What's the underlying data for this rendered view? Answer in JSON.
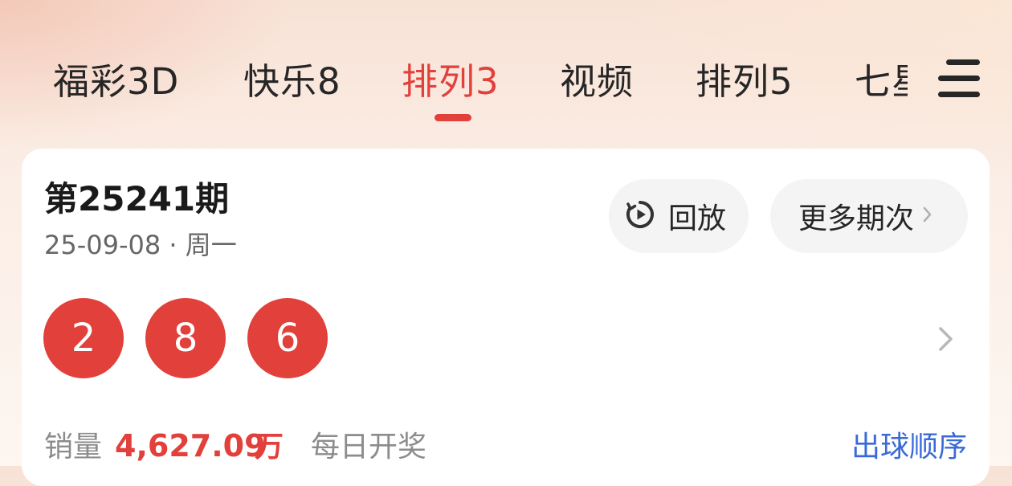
{
  "tabs": [
    {
      "label": "福彩3D",
      "active": false
    },
    {
      "label": "快乐8",
      "active": false
    },
    {
      "label": "排列3",
      "active": true
    },
    {
      "label": "视频",
      "active": false
    },
    {
      "label": "排列5",
      "active": false
    },
    {
      "label": "七星彩",
      "active": false
    }
  ],
  "menu_icon": "hamburger-menu-icon",
  "card": {
    "issue_title": "第25241期",
    "issue_date": "25-09-08 · 周一",
    "replay_label": "回放",
    "replay_icon": "replay-icon",
    "more_label": "更多期次",
    "numbers": [
      "2",
      "8",
      "6"
    ],
    "sales_label": "销量",
    "sales_value": "4,627.09",
    "sales_unit": "万",
    "draw_frequency": "每日开奖",
    "order_link": "出球顺序"
  },
  "colors": {
    "accent": "#e2403a",
    "link": "#3a6ad8",
    "text": "#262626",
    "muted": "#8c8c8c",
    "pill_bg": "#f4f4f4"
  }
}
